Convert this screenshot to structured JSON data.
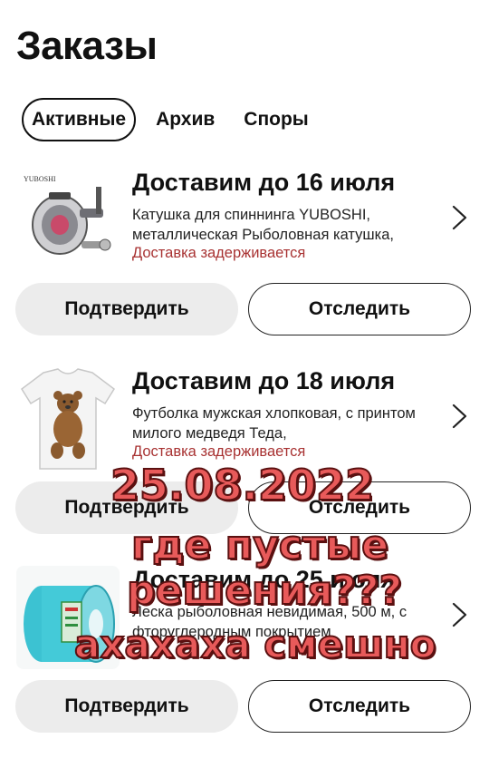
{
  "page": {
    "title": "Заказы"
  },
  "tabs": [
    {
      "label": "Активные",
      "active": true
    },
    {
      "label": "Архив",
      "active": false
    },
    {
      "label": "Споры",
      "active": false
    }
  ],
  "orders": [
    {
      "thumb_brand": "YUBOSHI",
      "delivery": "Доставим до 16 июля",
      "description": "Катушка для спиннинга YUBOSHI, металлическая Рыболовная катушка,",
      "status": "Доставка задерживается",
      "confirm_label": "Подтвердить",
      "track_label": "Отследить"
    },
    {
      "delivery": "Доставим до 18 июля",
      "description": "Футболка мужская хлопковая, с принтом милого медведя Теда,",
      "status": "Доставка задерживается",
      "confirm_label": "Подтвердить",
      "track_label": "Отследить"
    },
    {
      "delivery": "Доставим до 25 июля",
      "description": "Леска рыболовная невидимая, 500 м, с фторуглеродным покрытием",
      "status": "",
      "confirm_label": "Подтвердить",
      "track_label": "Отследить"
    }
  ],
  "overlay_text": {
    "line1": "25.08.2022",
    "line2": "где пустые",
    "line3": "решения???",
    "line4": "ахахаха смешно"
  },
  "colors": {
    "status_red": "#a83232",
    "overlay_fill": "#e85a5a",
    "overlay_stroke": "#5a1010",
    "confirm_bg": "#ececec"
  },
  "icons": [
    "chevron-right-icon"
  ]
}
